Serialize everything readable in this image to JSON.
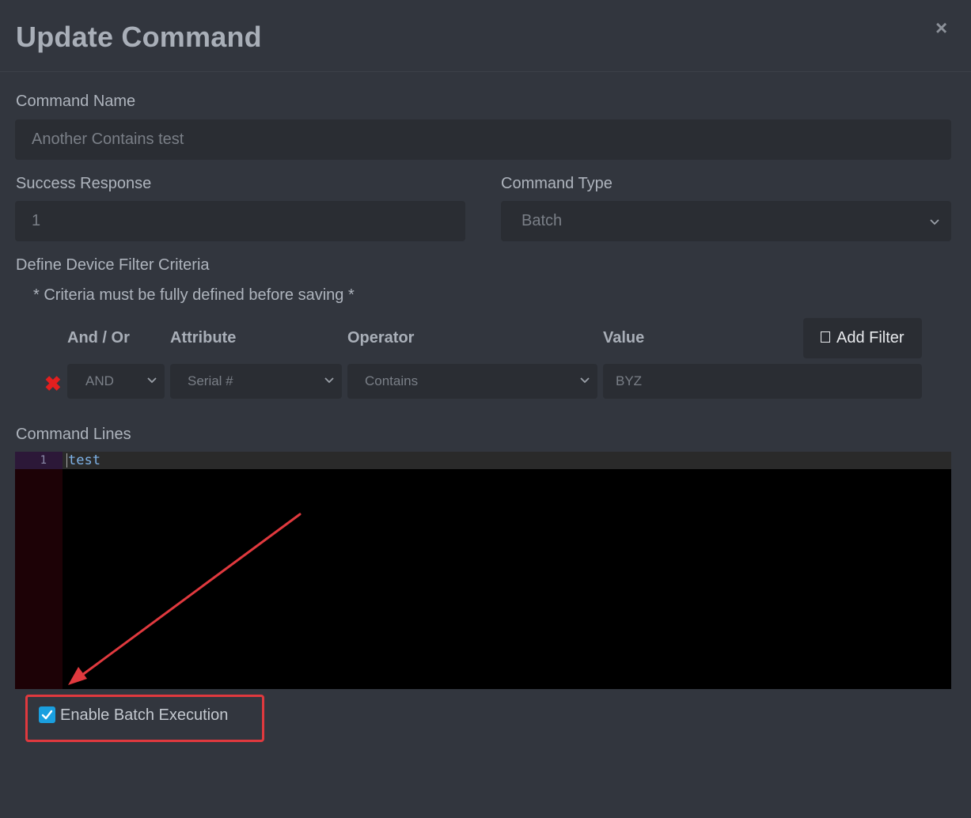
{
  "modal": {
    "title": "Update Command",
    "close_label": "×"
  },
  "command_name": {
    "label": "Command Name",
    "value": "Another Contains test"
  },
  "success_response": {
    "label": "Success Response",
    "value": "1"
  },
  "command_type": {
    "label": "Command Type",
    "selected": "Batch"
  },
  "filter": {
    "section_label": "Define Device Filter Criteria",
    "note": "* Criteria must be fully defined before saving *",
    "headers": {
      "and_or": "And / Or",
      "attribute": "Attribute",
      "operator": "Operator",
      "value": "Value"
    },
    "add_filter_label": "Add Filter",
    "rows": [
      {
        "and_or": "AND",
        "attribute": "Serial #",
        "operator": "Contains",
        "value": "BYZ"
      }
    ]
  },
  "command_lines": {
    "label": "Command Lines",
    "lines": [
      {
        "number": "1",
        "text": "test"
      }
    ]
  },
  "batch_execution": {
    "label": "Enable Batch Execution",
    "checked": true
  },
  "colors": {
    "background": "#32363e",
    "accent": "#1a9fdf",
    "highlight": "#e0393e",
    "delete": "#e21f1f"
  }
}
